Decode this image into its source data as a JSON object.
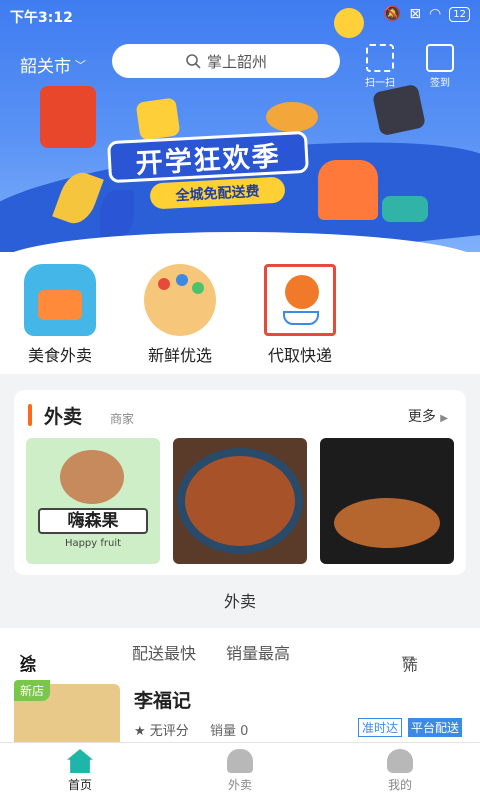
{
  "status": {
    "time": "下午3:12",
    "battery": "12"
  },
  "header": {
    "city": "韶关市",
    "search_placeholder": "掌上韶州",
    "scan_label": "扫一扫",
    "signin_label": "签到"
  },
  "banner": {
    "title": "开学狂欢季",
    "subtitle": "全城免配送费"
  },
  "quick": [
    {
      "label": "美食外卖"
    },
    {
      "label": "新鲜优选"
    },
    {
      "label": "代取快递"
    }
  ],
  "takeout": {
    "title": "外卖",
    "subtitle": "商家",
    "more": "更多",
    "shop1_name": "嗨森果",
    "shop1_en": "Happy fruit",
    "section_footer": "外卖"
  },
  "sort": {
    "comprehensive": "综合排序",
    "fastest": "配送最快",
    "top_sales": "销量最高",
    "filter": "筛选"
  },
  "listing": {
    "badge": "新店",
    "name": "李福记",
    "rating": "无评分",
    "sales": "销量 0",
    "tag1": "准时达",
    "tag2": "平台配送"
  },
  "tabs": [
    {
      "label": "首页"
    },
    {
      "label": "外卖"
    },
    {
      "label": "我的"
    }
  ],
  "colors": {
    "primary": "#3f7cf0",
    "accent": "#ff6a1a",
    "tab_active": "#1fb5a8"
  }
}
